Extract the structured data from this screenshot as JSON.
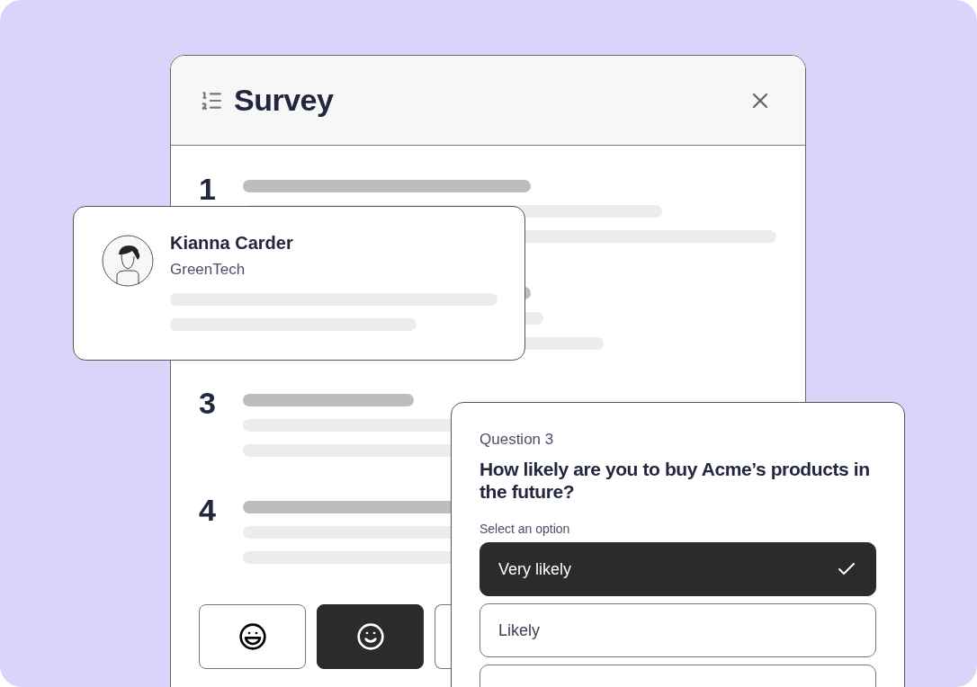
{
  "survey_window": {
    "title": "Survey",
    "questions": [
      {
        "kind": "numbered",
        "number": "1"
      },
      {
        "kind": "covered"
      },
      {
        "kind": "numbered",
        "number": "3"
      },
      {
        "kind": "numbered",
        "number": "4"
      }
    ],
    "mood_buttons": [
      {
        "selected": false
      },
      {
        "selected": true
      },
      {
        "selected": false
      }
    ]
  },
  "respondent_card": {
    "name": "Kianna Carder",
    "company": "GreenTech"
  },
  "question_card": {
    "label": "Question 3",
    "question": "How likely are you to buy Acme’s products in the future?",
    "hint": "Select an option",
    "options": [
      {
        "label": "Very likely",
        "selected": true
      },
      {
        "label": "Likely",
        "selected": false
      },
      {
        "selected": false
      }
    ]
  }
}
